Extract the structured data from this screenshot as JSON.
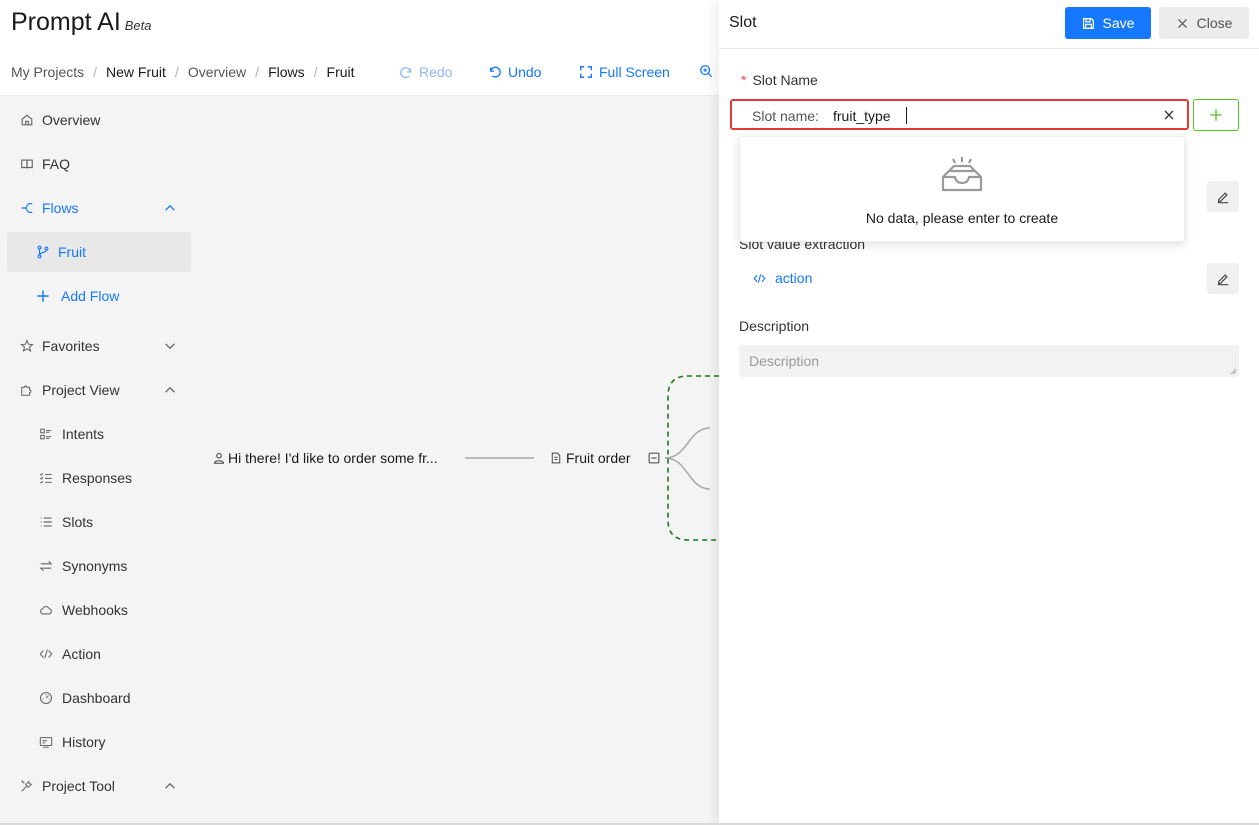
{
  "app": {
    "brand": "Prompt AI",
    "badge": "Beta"
  },
  "breadcrumb": [
    "My Projects",
    "New Fruit",
    "Overview",
    "Flows",
    "Fruit"
  ],
  "toolbar": {
    "redo": "Redo",
    "undo": "Undo",
    "fullscreen": "Full Screen"
  },
  "sidebar": {
    "overview": "Overview",
    "faq": "FAQ",
    "flows": "Flows",
    "fruit": "Fruit",
    "add_flow": "Add Flow",
    "favorites": "Favorites",
    "project_view": "Project View",
    "intents": "Intents",
    "responses": "Responses",
    "slots": "Slots",
    "synonyms": "Synonyms",
    "webhooks": "Webhooks",
    "action": "Action",
    "dashboard": "Dashboard",
    "history": "History",
    "project_tool": "Project Tool"
  },
  "canvas": {
    "user_node": "Hi there! I'd like to order some fr...",
    "flow_node": "Fruit order"
  },
  "drawer": {
    "title": "Slot",
    "save": "Save",
    "close": "Close",
    "slot_name_label": "Slot Name",
    "slot_prefix": "Slot name:",
    "slot_value": "fruit_type",
    "empty_text": "No data, please enter to create",
    "extraction_label": "Slot value extraction",
    "action_link": "action",
    "description_label": "Description",
    "description_placeholder": "Description"
  },
  "colors": {
    "primary": "#1677ff",
    "danger": "#e53935",
    "success": "#52c41a",
    "flow_border": "#1a7a1a"
  }
}
